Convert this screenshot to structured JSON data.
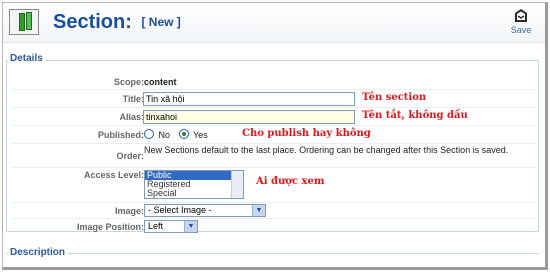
{
  "header": {
    "title": "Section:",
    "subtitle": "[ New ]",
    "save_label": "Save"
  },
  "details": {
    "legend": "Details",
    "scope": {
      "label": "Scope:",
      "value": "content"
    },
    "title_field": {
      "label": "Title:",
      "value": "Tin xã hội",
      "note": "Tên section"
    },
    "alias_field": {
      "label": "Alias:",
      "value": "tinxahoi",
      "note": "Tên tắt, không dấu"
    },
    "published": {
      "label": "Published:",
      "no": "No",
      "yes": "Yes",
      "selected": "Yes",
      "note": "Cho publish hay không"
    },
    "order": {
      "label": "Order:",
      "text": "New Sections default to the last place. Ordering can be changed after this Section is saved."
    },
    "access_level": {
      "label": "Access Level:",
      "options": [
        "Public",
        "Registered",
        "Special"
      ],
      "selected": "Public",
      "note": "Ai được xem"
    },
    "image": {
      "label": "Image:",
      "value": "- Select Image -"
    },
    "image_position": {
      "label": "Image Position:",
      "value": "Left"
    }
  },
  "description": {
    "legend": "Description"
  },
  "colors": {
    "title": "#1a4f9c",
    "note": "#e0161c",
    "legend": "#2a5a9c"
  },
  "icons": {
    "logo": "section-manager-icon",
    "save": "save-icon"
  }
}
